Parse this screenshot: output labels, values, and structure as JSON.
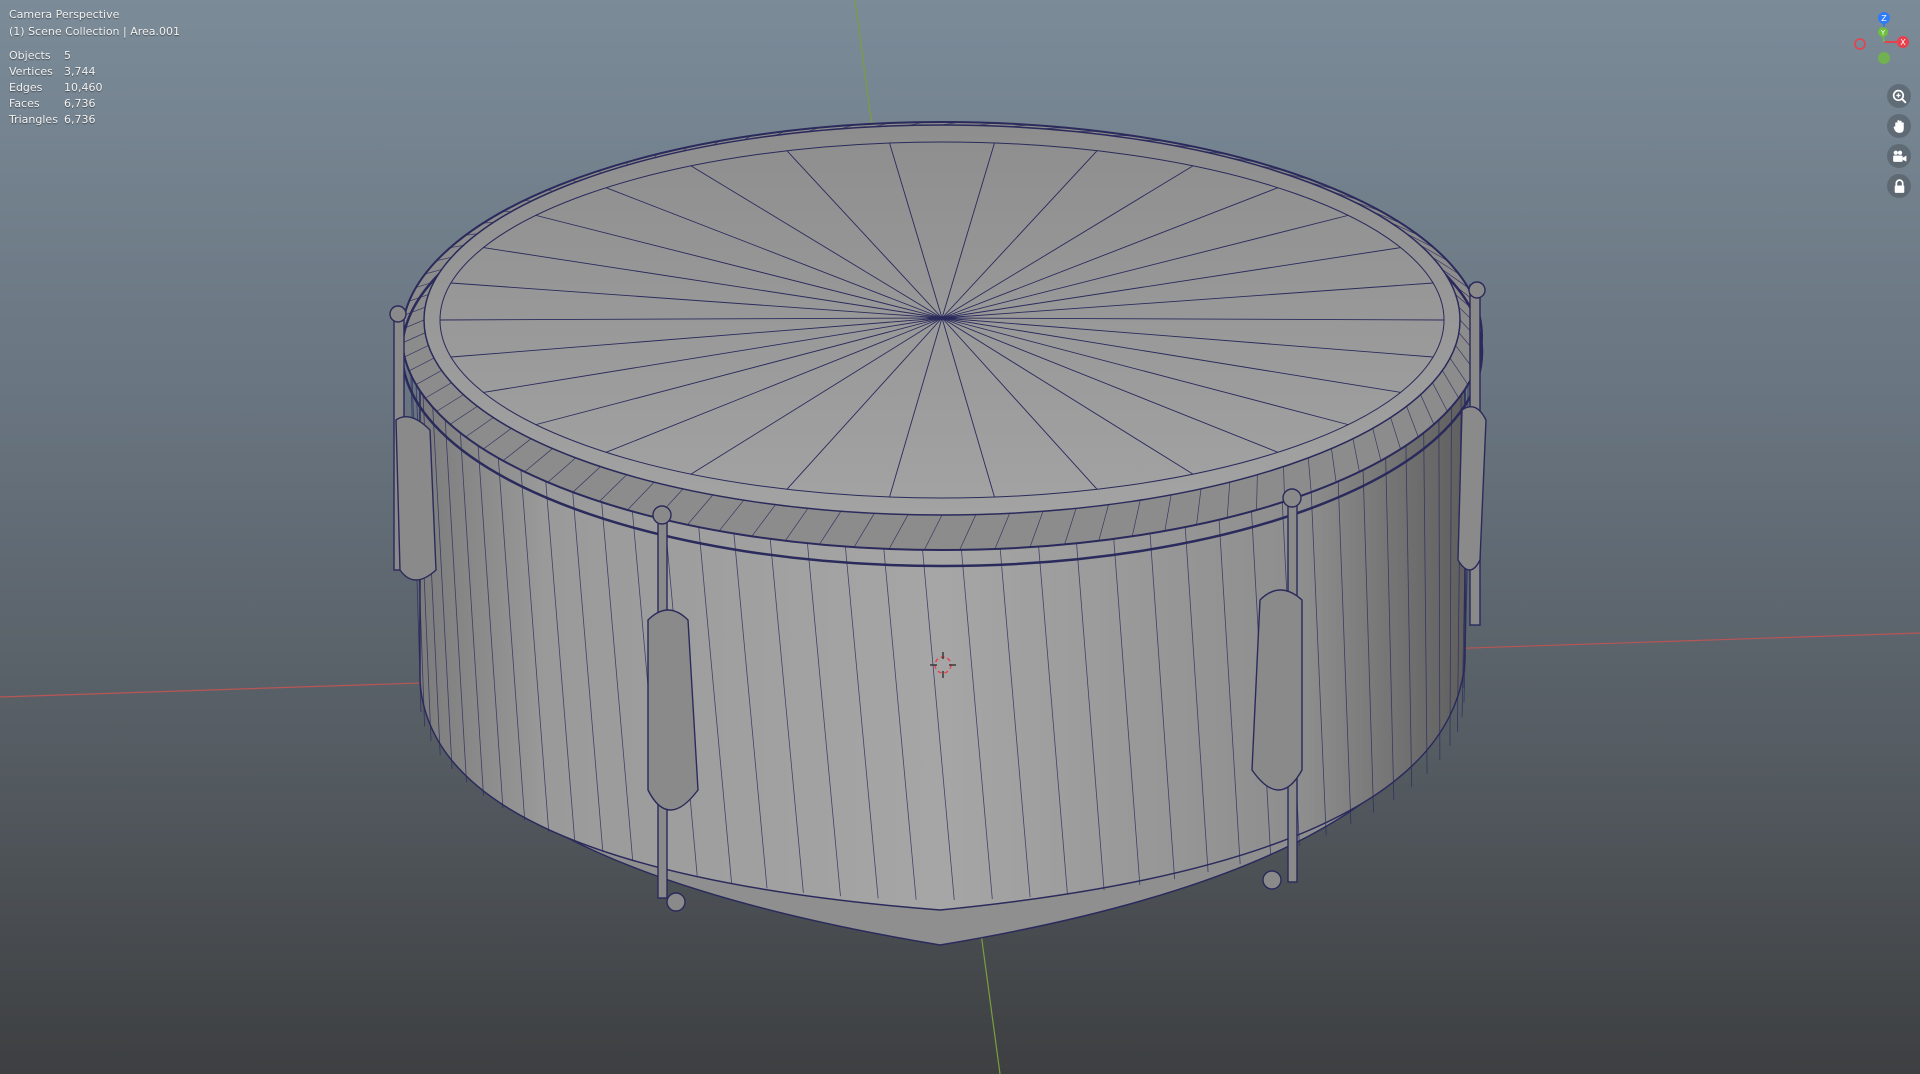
{
  "viewport": {
    "mode_label": "Camera Perspective",
    "collection_label": "(1) Scene Collection | Area.001",
    "stats": [
      {
        "label": "Objects",
        "value": "5"
      },
      {
        "label": "Vertices",
        "value": "3,744"
      },
      {
        "label": "Edges",
        "value": "10,460"
      },
      {
        "label": "Faces",
        "value": "6,736"
      },
      {
        "label": "Triangles",
        "value": "6,736"
      }
    ]
  },
  "gizmo": {
    "axes": [
      {
        "label": "Z",
        "color": "#2f7cf6"
      },
      {
        "label": "Y",
        "color": "#6fbf3c"
      },
      {
        "label": "X",
        "color": "#e8414e"
      }
    ]
  },
  "tools": [
    {
      "name": "zoom",
      "icon": "zoom-icon"
    },
    {
      "name": "pan",
      "icon": "hand-icon"
    },
    {
      "name": "camera",
      "icon": "camera-icon"
    },
    {
      "name": "lock",
      "icon": "lock-icon"
    }
  ],
  "colors": {
    "x_axis": "#b85555",
    "y_axis": "#7a9e3c",
    "wire": "#2a2a5c",
    "mesh_fill": "#9b9b9b"
  }
}
